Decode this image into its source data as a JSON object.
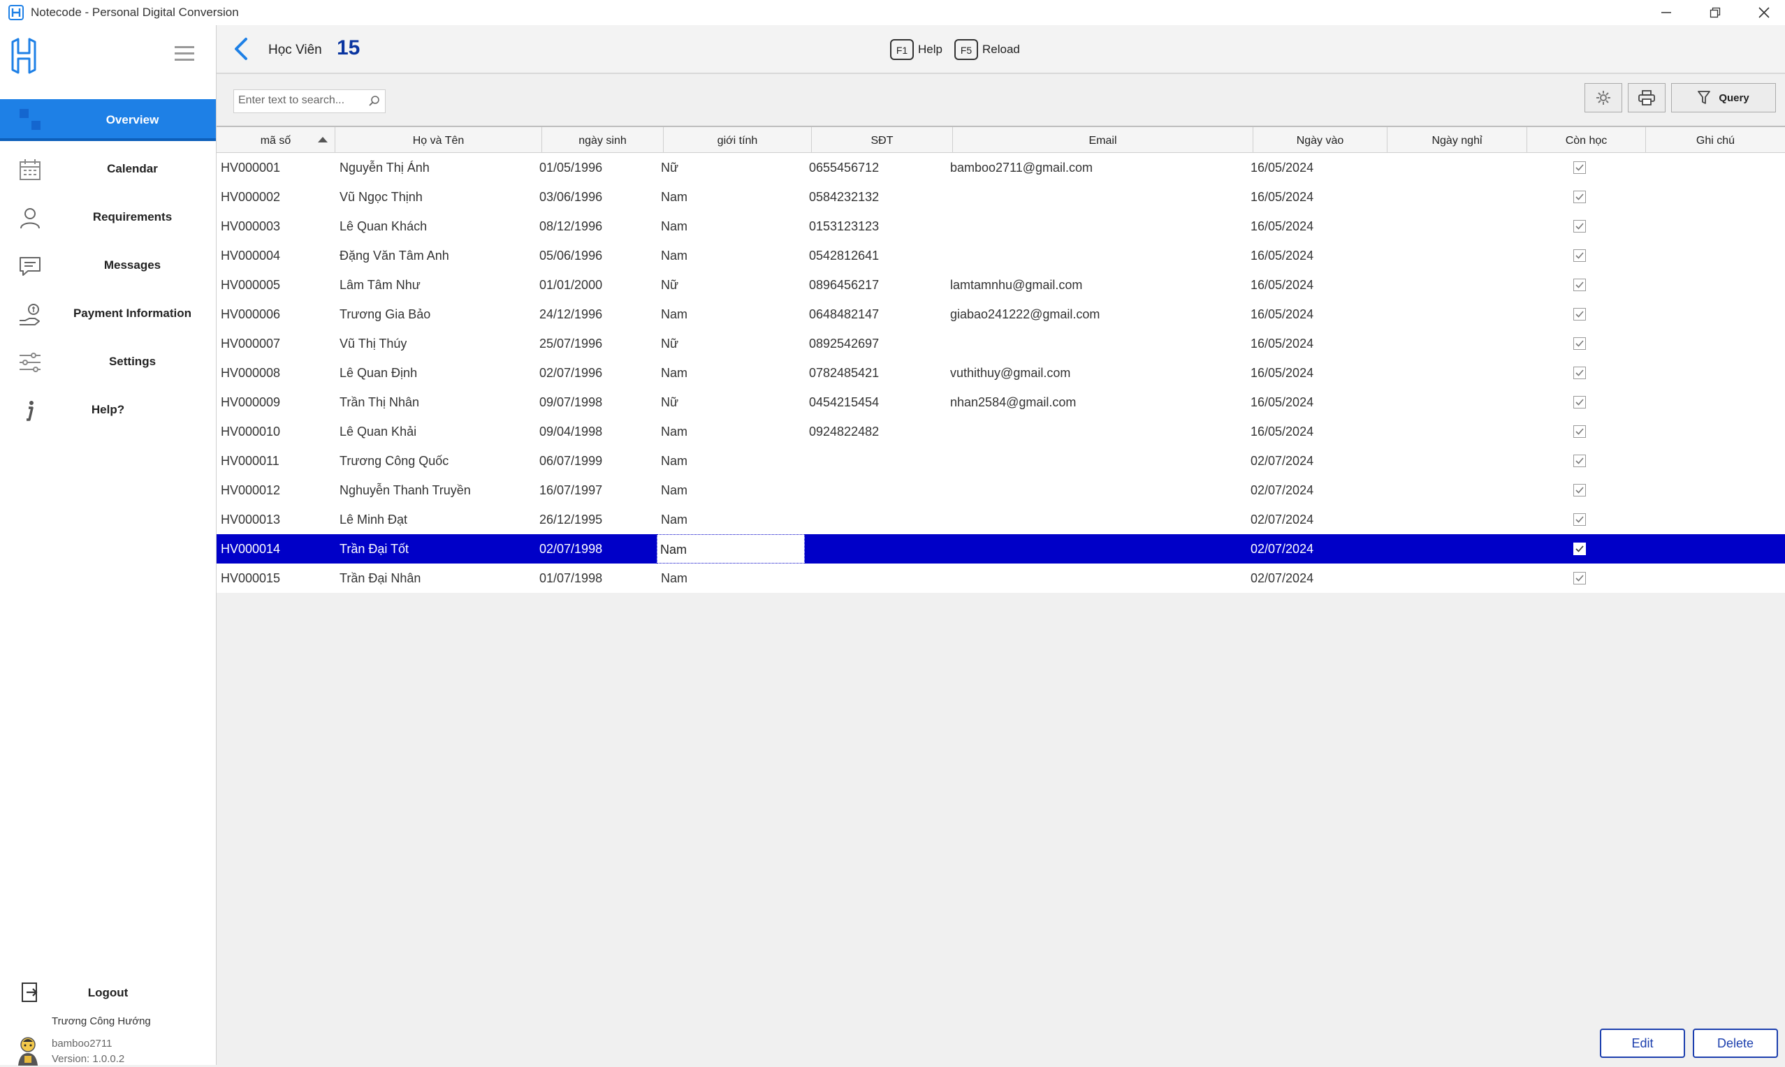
{
  "window": {
    "title": "Notecode - Personal Digital Conversion",
    "minimize_icon": "minimize-icon",
    "maximize_icon": "restore-icon",
    "close_icon": "close-icon"
  },
  "colors": {
    "accent": "#1e80e6",
    "selected_row": "#0000c8",
    "count": "#0a35a0",
    "button_border": "#1c3fae"
  },
  "sidebar": {
    "items": [
      {
        "label": "Overview",
        "icon": "overview-icon",
        "active": true
      },
      {
        "label": "Calendar",
        "icon": "calendar-icon"
      },
      {
        "label": "Requirements",
        "icon": "user-icon"
      },
      {
        "label": "Messages",
        "icon": "message-icon"
      },
      {
        "label": "Payment Information",
        "icon": "payment-icon"
      },
      {
        "label": "Settings",
        "icon": "sliders-icon"
      },
      {
        "label": "Help?",
        "icon": "info-icon"
      }
    ],
    "logout": "Logout",
    "user": {
      "name": "Trương Công Hướng",
      "login": "bamboo2711",
      "version": "Version: 1.0.0.2"
    }
  },
  "header": {
    "page_label": "Học Viên",
    "count": "15",
    "help_key": "F1",
    "help_label": "Help",
    "reload_key": "F5",
    "reload_label": "Reload"
  },
  "toolbar": {
    "search_placeholder": "Enter text to search...",
    "query_label": "Query"
  },
  "table": {
    "columns": [
      "mã số",
      "Họ và Tên",
      "ngày sinh",
      "giới tính",
      "SĐT",
      "Email",
      "Ngày vào",
      "Ngày nghỉ",
      "Còn học",
      "Ghi chú"
    ],
    "sorted_column": "mã số",
    "selected_row": 13,
    "rows": [
      [
        "HV000001",
        "Nguyễn Thị Ánh",
        "01/05/1996",
        "Nữ",
        "0655456712",
        "bamboo2711@gmail.com",
        "16/05/2024",
        "",
        true,
        ""
      ],
      [
        "HV000002",
        "Vũ Ngọc Thịnh",
        "03/06/1996",
        "Nam",
        "0584232132",
        "",
        "16/05/2024",
        "",
        true,
        ""
      ],
      [
        "HV000003",
        "Lê Quan Khách",
        "08/12/1996",
        "Nam",
        "0153123123",
        "",
        "16/05/2024",
        "",
        true,
        ""
      ],
      [
        "HV000004",
        "Đặng Văn Tâm Anh",
        "05/06/1996",
        "Nam",
        "0542812641",
        "",
        "16/05/2024",
        "",
        true,
        ""
      ],
      [
        "HV000005",
        "Lâm Tâm Như",
        "01/01/2000",
        "Nữ",
        "0896456217",
        "lamtamnhu@gmail.com",
        "16/05/2024",
        "",
        true,
        ""
      ],
      [
        "HV000006",
        "Trương Gia Bảo",
        "24/12/1996",
        "Nam",
        "0648482147",
        "giabao241222@gmail.com",
        "16/05/2024",
        "",
        true,
        ""
      ],
      [
        "HV000007",
        "Vũ Thị Thúy",
        "25/07/1996",
        "Nữ",
        "0892542697",
        "",
        "16/05/2024",
        "",
        true,
        ""
      ],
      [
        "HV000008",
        "Lê Quan Định",
        "02/07/1996",
        "Nam",
        "0782485421",
        "vuthithuy@gmail.com",
        "16/05/2024",
        "",
        true,
        ""
      ],
      [
        "HV000009",
        "Trần Thị Nhân",
        "09/07/1998",
        "Nữ",
        "0454215454",
        "nhan2584@gmail.com",
        "16/05/2024",
        "",
        true,
        ""
      ],
      [
        "HV000010",
        "Lê Quan Khải",
        "09/04/1998",
        "Nam",
        "0924822482",
        "",
        "16/05/2024",
        "",
        true,
        ""
      ],
      [
        "HV000011",
        "Trương Công Quốc",
        "06/07/1999",
        "Nam",
        "",
        "",
        "02/07/2024",
        "",
        true,
        ""
      ],
      [
        "HV000012",
        "Nghuyễn Thanh Truyền",
        "16/07/1997",
        "Nam",
        "",
        "",
        "02/07/2024",
        "",
        true,
        ""
      ],
      [
        "HV000013",
        "Lê Minh Đạt",
        "26/12/1995",
        "Nam",
        "",
        "",
        "02/07/2024",
        "",
        true,
        ""
      ],
      [
        "HV000014",
        "Trần Đại Tốt",
        "02/07/1998",
        "Nam",
        "",
        "",
        "02/07/2024",
        "",
        true,
        ""
      ],
      [
        "HV000015",
        "Trần Đại Nhân",
        "01/07/1998",
        "Nam",
        "",
        "",
        "02/07/2024",
        "",
        true,
        ""
      ]
    ]
  },
  "footer": {
    "edit_label": "Edit",
    "delete_label": "Delete"
  }
}
